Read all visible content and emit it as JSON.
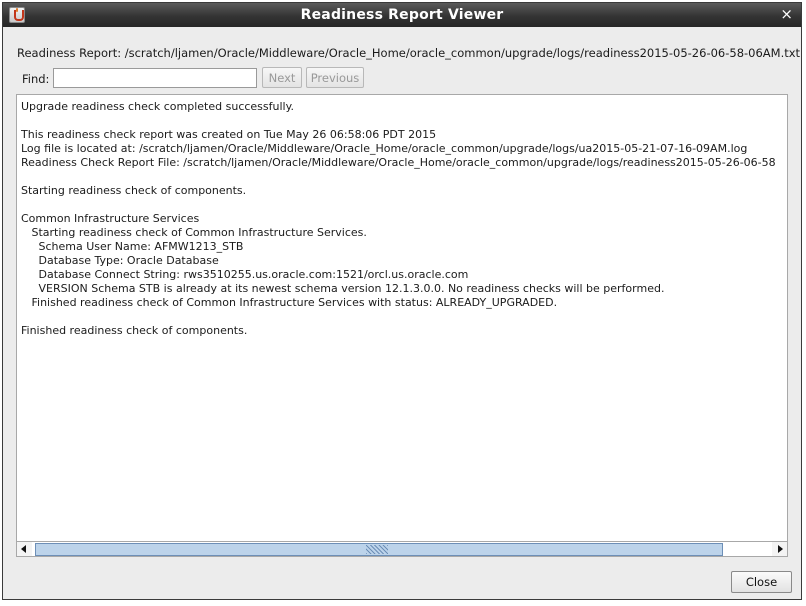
{
  "window": {
    "title": "Readiness Report Viewer",
    "close_glyph": "×"
  },
  "report_path": "Readiness Report: /scratch/ljamen/Oracle/Middleware/Oracle_Home/oracle_common/upgrade/logs/readiness2015-05-26-06-58-06AM.txt",
  "find": {
    "label": "Find:",
    "value": "",
    "next_label": "Next",
    "previous_label": "Previous"
  },
  "report_text": "Upgrade readiness check completed successfully.\n\nThis readiness check report was created on Tue May 26 06:58:06 PDT 2015\nLog file is located at: /scratch/ljamen/Oracle/Middleware/Oracle_Home/oracle_common/upgrade/logs/ua2015-05-21-07-16-09AM.log\nReadiness Check Report File: /scratch/ljamen/Oracle/Middleware/Oracle_Home/oracle_common/upgrade/logs/readiness2015-05-26-06-58\n\nStarting readiness check of components.\n\nCommon Infrastructure Services\n   Starting readiness check of Common Infrastructure Services.\n     Schema User Name: AFMW1213_STB\n     Database Type: Oracle Database\n     Database Connect String: rws3510255.us.oracle.com:1521/orcl.us.oracle.com\n     VERSION Schema STB is already at its newest schema version 12.1.3.0.0. No readiness checks will be performed.\n   Finished readiness check of Common Infrastructure Services with status: ALREADY_UPGRADED.\n\nFinished readiness check of components.",
  "close_button_label": "Close",
  "icons": {
    "app": "java-cup-icon",
    "close": "close-icon",
    "scroll_left": "arrow-left-icon",
    "scroll_right": "arrow-right-icon"
  }
}
